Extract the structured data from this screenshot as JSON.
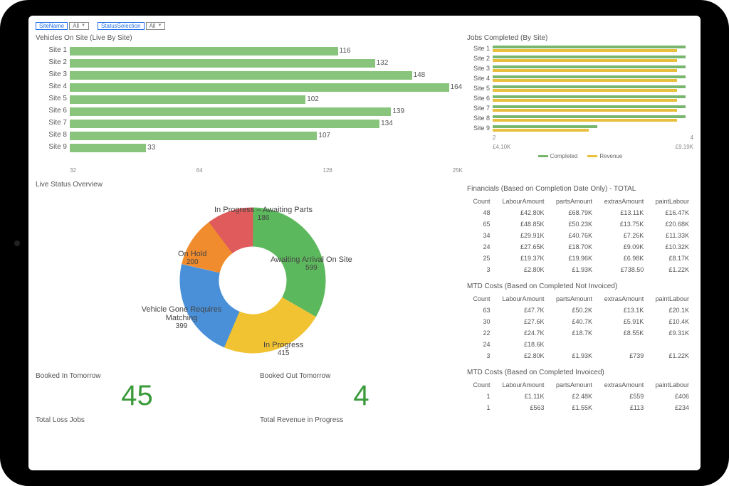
{
  "filters": {
    "siteName": {
      "label": "SiteName",
      "value": "All"
    },
    "statusSelection": {
      "label": "StatusSelection",
      "value": "All"
    }
  },
  "vehiclesOnSite": {
    "title": "Vehicles On Site (Live By Site)",
    "axis": [
      "32",
      "64",
      "128",
      "25K"
    ]
  },
  "jobsCompleted": {
    "title": "Jobs Completed (By Site)",
    "axis": [
      "2",
      "4"
    ],
    "axis2": [
      "£4.10K",
      "£9.19K"
    ],
    "legend": [
      "Completed",
      "Revenue"
    ]
  },
  "chart_data": [
    {
      "type": "bar",
      "title": "Vehicles On Site (Live By Site)",
      "categories": [
        "Site 1",
        "Site 2",
        "Site 3",
        "Site 4",
        "Site 5",
        "Site 6",
        "Site 7",
        "Site 8",
        "Site 9"
      ],
      "values": [
        116,
        132,
        148,
        164,
        102,
        139,
        134,
        107,
        33
      ],
      "orientation": "horizontal",
      "xlabel": "",
      "ylabel": ""
    },
    {
      "type": "bar",
      "title": "Jobs Completed (By Site)",
      "categories": [
        "Site 1",
        "Site 2",
        "Site 3",
        "Site 4",
        "Site 5",
        "Site 6",
        "Site 7",
        "Site 8",
        "Site 9"
      ],
      "series": [
        {
          "name": "Completed",
          "values": [
            4,
            4,
            4,
            4,
            4,
            4,
            4,
            4,
            2
          ],
          "color": "#78b66d"
        },
        {
          "name": "Revenue (£K)",
          "values": [
            9.0,
            9.0,
            9.0,
            9.0,
            9.0,
            9.0,
            9.0,
            9.0,
            4.1
          ],
          "color": "#e9c03d"
        }
      ],
      "orientation": "horizontal"
    },
    {
      "type": "pie",
      "title": "Live Status Overview",
      "categories": [
        "Awaiting Arrival On Site",
        "In Progress",
        "Vehicle Gone Requires Matching",
        "On Hold",
        "In Progress – Awaiting Parts"
      ],
      "values": [
        599,
        415,
        399,
        200,
        186
      ],
      "colors": [
        "#5cb85c",
        "#f1c232",
        "#4a90d9",
        "#f08c2e",
        "#e05b5b"
      ]
    }
  ],
  "status": {
    "title": "Live Status Overview",
    "segments": [
      {
        "label": "Awaiting Arrival On Site",
        "count": "599"
      },
      {
        "label": "In Progress",
        "count": "415"
      },
      {
        "label": "Vehicle Gone Requires Matching",
        "count": "399"
      },
      {
        "label": "On Hold",
        "count": "200"
      },
      {
        "label": "In Progress – Awaiting Parts",
        "count": "186"
      }
    ]
  },
  "bookedIn": {
    "title": "Booked In Tomorrow",
    "value": "45"
  },
  "bookedOut": {
    "title": "Booked Out Tomorrow",
    "value": "4"
  },
  "totalLoss": {
    "title": "Total Loss Jobs"
  },
  "totalRevenue": {
    "title": "Total Revenue in Progress"
  },
  "finTotal": {
    "title": "Financials (Based on Completion Date Only) - TOTAL",
    "headers": [
      "Count",
      "LabourAmount",
      "partsAmount",
      "extrasAmount",
      "paintLabour"
    ],
    "rows": [
      [
        "48",
        "£42.80K",
        "£68.79K",
        "£13.11K",
        "£16.47K"
      ],
      [
        "65",
        "£48.85K",
        "£50.23K",
        "£13.75K",
        "£20.68K"
      ],
      [
        "34",
        "£29.91K",
        "£40.76K",
        "£7.26K",
        "£11.33K"
      ],
      [
        "24",
        "£27.65K",
        "£18.70K",
        "£9.09K",
        "£10.32K"
      ],
      [
        "25",
        "£19.37K",
        "£19.96K",
        "£6.98K",
        "£8.17K"
      ],
      [
        "3",
        "£2.80K",
        "£1.93K",
        "£738.50",
        "£1.22K"
      ]
    ]
  },
  "mtdNotInv": {
    "title": "MTD Costs (Based on Completed Not Invoiced)",
    "rows": [
      [
        "63",
        "£47.7K",
        "£50.2K",
        "£13.1K",
        "£20.1K"
      ],
      [
        "30",
        "£27.6K",
        "£40.7K",
        "£5.91K",
        "£10.4K"
      ],
      [
        "22",
        "£24.7K",
        "£18.7K",
        "£8.55K",
        "£9.31K"
      ],
      [
        "24",
        "£18.6K",
        "",
        "",
        ""
      ],
      [
        "3",
        "£2.80K",
        "£1.93K",
        "£739",
        "£1.22K"
      ]
    ]
  },
  "mtdInv": {
    "title": "MTD Costs (Based on Completed Invoiced)",
    "rows": [
      [
        "1",
        "£1.11K",
        "£2.48K",
        "£559",
        "£406"
      ],
      [
        "1",
        "£563",
        "£1.55K",
        "£113",
        "£234"
      ]
    ]
  }
}
